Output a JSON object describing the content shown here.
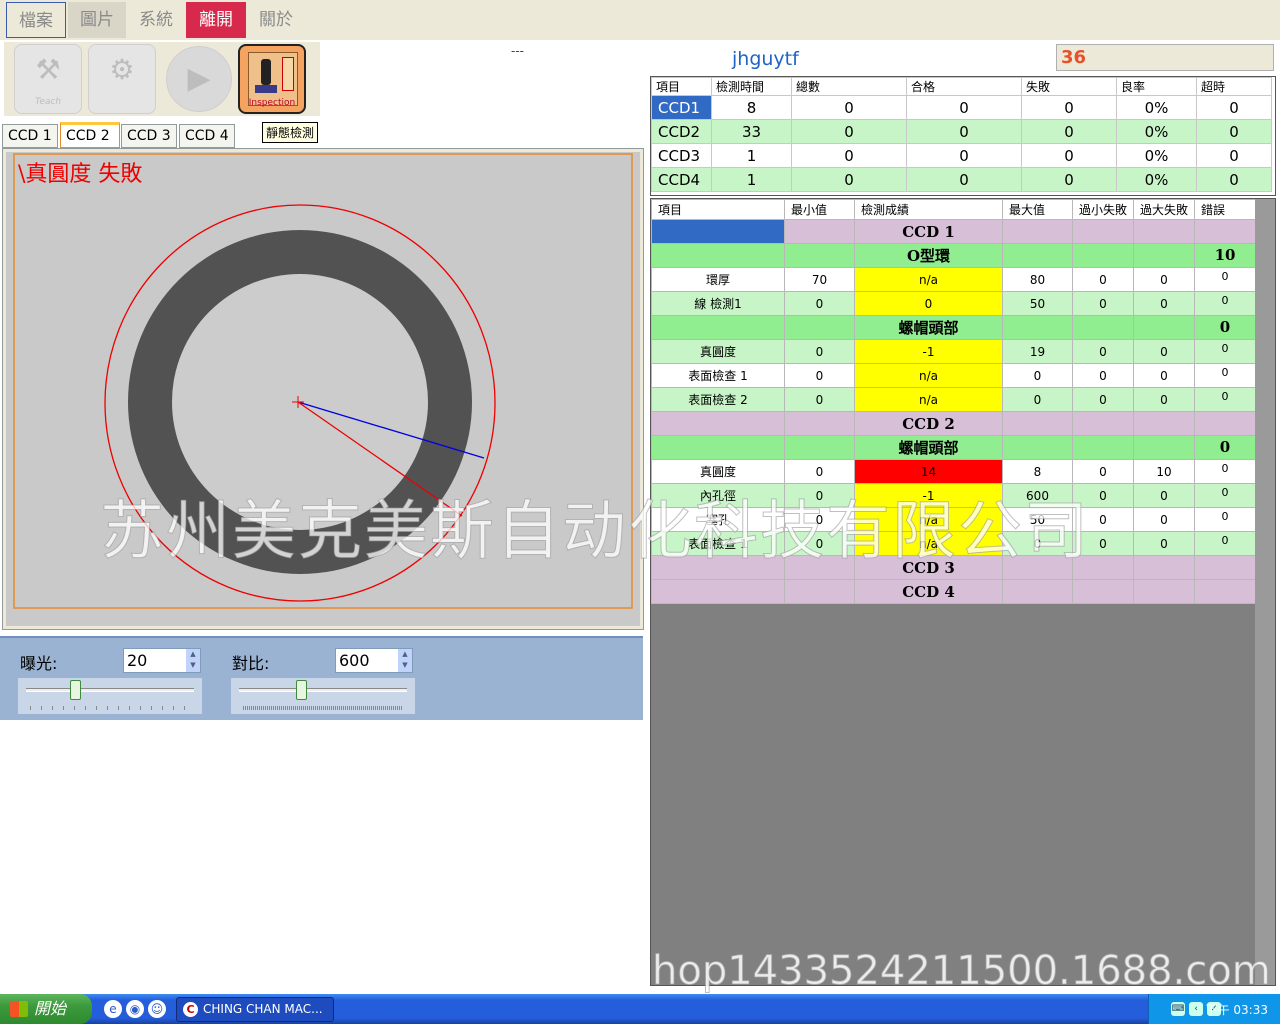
{
  "menu": [
    "檔案",
    "圖片",
    "系統",
    "離開",
    "關於"
  ],
  "toolbar": {
    "teach_caption": "Teach",
    "inspection_caption": "Inspection",
    "tooltip": "靜態檢測",
    "dash": "---"
  },
  "header": {
    "name": "jhguytf",
    "count": "36"
  },
  "ccd_tabs": [
    "CCD 1",
    "CCD 2",
    "CCD 3",
    "CCD 4"
  ],
  "image": {
    "result_text": "\\真圓度 失敗"
  },
  "controls": {
    "exposure": {
      "label": "曝光:",
      "value": "20",
      "fraction": 0.28
    },
    "contrast": {
      "label": "對比:",
      "value": "600",
      "fraction": 0.36
    }
  },
  "summary": {
    "headers": [
      "項目",
      "檢測時間",
      "總數",
      "合格",
      "失敗",
      "良率",
      "超時"
    ],
    "rows": [
      [
        "CCD1",
        "8",
        "0",
        "0",
        "0",
        "0%",
        "0"
      ],
      [
        "CCD2",
        "33",
        "0",
        "0",
        "0",
        "0%",
        "0"
      ],
      [
        "CCD3",
        "1",
        "0",
        "0",
        "0",
        "0%",
        "0"
      ],
      [
        "CCD4",
        "1",
        "0",
        "0",
        "0",
        "0%",
        "0"
      ]
    ]
  },
  "detail": {
    "headers": [
      "項目",
      "最小值",
      "檢測成績",
      "最大值",
      "過小失敗",
      "過大失敗",
      "錯誤"
    ],
    "rows": [
      {
        "type": "grp",
        "cells": [
          "",
          "",
          "CCD 1",
          "",
          "",
          "",
          ""
        ],
        "first_blue": true
      },
      {
        "type": "sub",
        "cells": [
          "",
          "",
          "O型環",
          "",
          "",
          "",
          "10"
        ]
      },
      {
        "type": "w",
        "cells": [
          "環厚",
          "70",
          "n/a",
          "80",
          "0",
          "0",
          "0"
        ],
        "val": "yl"
      },
      {
        "type": "lg",
        "cells": [
          "線 檢測1",
          "0",
          "0",
          "50",
          "0",
          "0",
          "0"
        ],
        "val": "yl"
      },
      {
        "type": "sub",
        "cells": [
          "",
          "",
          "螺帽頭部",
          "",
          "",
          "",
          "0"
        ]
      },
      {
        "type": "lg",
        "cells": [
          "真圓度",
          "0",
          "-1",
          "19",
          "0",
          "0",
          "0"
        ],
        "val": "yl"
      },
      {
        "type": "w",
        "cells": [
          "表面檢查 1",
          "0",
          "n/a",
          "0",
          "0",
          "0",
          "0"
        ],
        "val": "yl"
      },
      {
        "type": "lg",
        "cells": [
          "表面檢查 2",
          "0",
          "n/a",
          "0",
          "0",
          "0",
          "0"
        ],
        "val": "yl"
      },
      {
        "type": "grp",
        "cells": [
          "",
          "",
          "CCD 2",
          "",
          "",
          "",
          ""
        ]
      },
      {
        "type": "sub",
        "cells": [
          "",
          "",
          "螺帽頭部",
          "",
          "",
          "",
          "0"
        ]
      },
      {
        "type": "w",
        "cells": [
          "真圓度",
          "0",
          "14",
          "8",
          "0",
          "10",
          "0"
        ],
        "val": "rd"
      },
      {
        "type": "lg",
        "cells": [
          "內孔徑",
          "0",
          "-1",
          "600",
          "0",
          "0",
          "0"
        ],
        "val": "yl"
      },
      {
        "type": "w",
        "cells": [
          "塞孔",
          "0",
          "n/a",
          "50",
          "0",
          "0",
          "0"
        ],
        "val": "yl"
      },
      {
        "type": "lg",
        "cells": [
          "表面檢查 1",
          "0",
          "n/a",
          "0",
          "0",
          "0",
          "0"
        ],
        "val": "yl"
      },
      {
        "type": "grp",
        "cells": [
          "",
          "",
          "CCD 3",
          "",
          "",
          "",
          ""
        ]
      },
      {
        "type": "grp",
        "cells": [
          "",
          "",
          "CCD 4",
          "",
          "",
          "",
          ""
        ]
      }
    ]
  },
  "watermark": {
    "company": "苏州美克美斯自动化科技有限公司",
    "shop": "hop1433524211500.1688.com"
  },
  "taskbar": {
    "start": "開始",
    "task": "CHING CHAN MAC...",
    "clock": "下午 03:33"
  },
  "colors": {
    "fail_red": "#ff0000",
    "value_yellow": "#ffff00",
    "group_purple": "#d8bfd8",
    "section_green": "#90ee90",
    "row_green": "#c8f5c8",
    "select_blue": "#316ac5"
  }
}
